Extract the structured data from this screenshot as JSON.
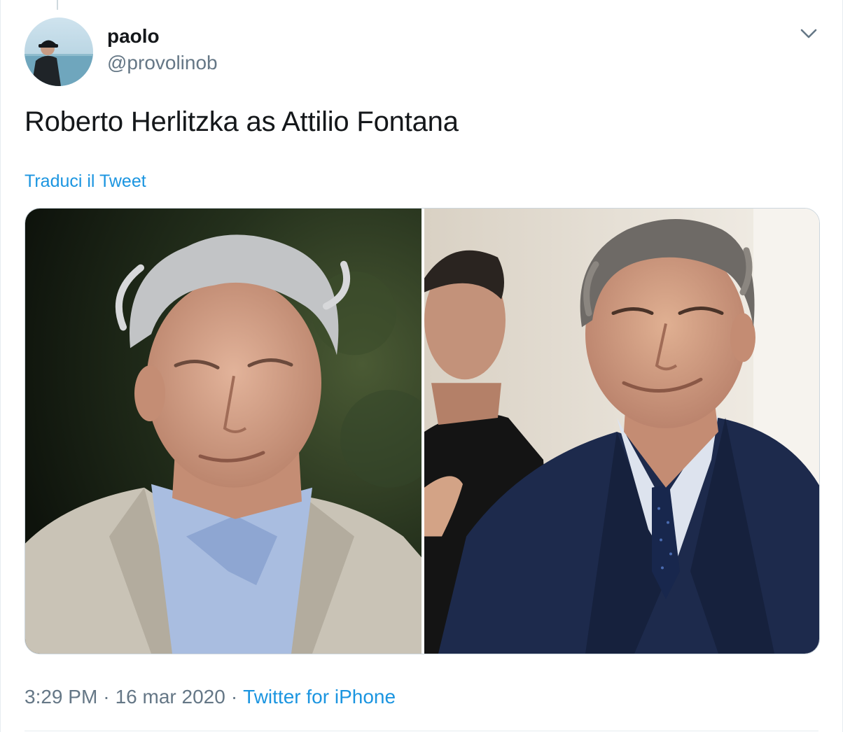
{
  "author": {
    "display_name": "paolo",
    "handle": "@provolinob",
    "avatar_icon": "profile-photo-avatar"
  },
  "menu": {
    "icon": "chevron-down-icon"
  },
  "tweet": {
    "text": "Roberto Herlitzka as Attilio Fontana",
    "translate_label": "Traduci il Tweet"
  },
  "meta": {
    "time": "3:29 PM",
    "separator": "·",
    "date": "16 mar 2020",
    "source": "Twitter for iPhone"
  },
  "colors": {
    "link": "#1b95e0",
    "text": "#14171a",
    "secondary": "#657786",
    "border": "#ccd6dd"
  }
}
